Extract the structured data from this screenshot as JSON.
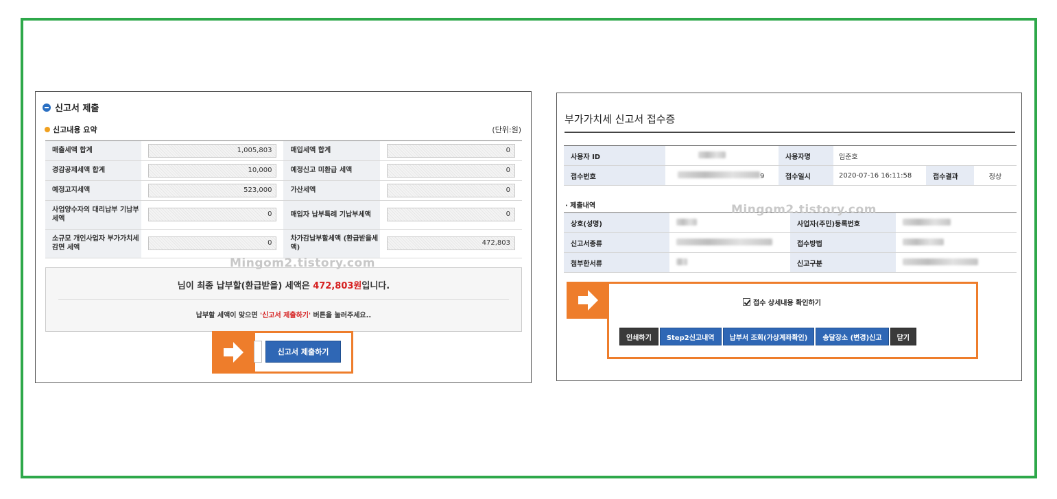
{
  "left": {
    "title": "신고서 제출",
    "subtitle": "신고내용 요약",
    "unit": "(단위:원)",
    "rows": [
      {
        "l1": "매출세액 합계",
        "v1": "1,005,803",
        "l2": "매입세액 합계",
        "v2": "0"
      },
      {
        "l1": "경감공제세액 합계",
        "v1": "10,000",
        "l2": "예정신고 미환급 세액",
        "v2": "0"
      },
      {
        "l1": "예정고지세액",
        "v1": "523,000",
        "l2": "가산세액",
        "v2": "0"
      },
      {
        "l1": "사업양수자의 대리납부 기납부세액",
        "v1": "0",
        "l2": "매입자 납부특례 기납부세액",
        "v2": "0"
      },
      {
        "l1": "소규모 개인사업자 부가가치세 감면 세액",
        "v1": "0",
        "l2": "차가감납부할세액 (환급받을세액)",
        "v2": "472,803"
      }
    ],
    "notice_prefix": "님이 최종 납부할(환급받을) 세액은 ",
    "notice_amount": "472,803원",
    "notice_suffix": "입니다.",
    "sub_prefix": "납부할 세액이 맞으면 ",
    "sub_highlight": "'신고서 제출하기'",
    "sub_suffix": " 버튼을 눌러주세요..",
    "submit_label": "신고서 제출하기",
    "watermark": "Mingom2.tistory.com"
  },
  "right": {
    "title": "부가가치세 신고서 접수증",
    "info": {
      "user_id_label": "사용자 ID",
      "user_name_label": "사용자명",
      "user_name": "임준호",
      "receipt_no_label": "접수번호",
      "receipt_no_suffix": "9",
      "receipt_date_label": "접수일시",
      "receipt_date": "2020-07-16 16:11:58",
      "result_label": "접수결과",
      "result": "정상"
    },
    "section_title": "제출내역",
    "details": [
      {
        "l1": "상호(성명)",
        "l2": "사업자(주민)등록번호"
      },
      {
        "l1": "신고서종류",
        "l2": "접수방법"
      },
      {
        "l1": "첨부한서류",
        "l2": "신고구분"
      }
    ],
    "checkbox_label": "접수 상세내용 확인하기",
    "buttons": {
      "print": "인쇄하기",
      "step2": "Step2신고내역",
      "payment": "납부서 조회(가상계좌확인)",
      "address": "송달장소 (변경)신고",
      "close": "닫기"
    },
    "watermark": "Mingom2.tistory.com"
  },
  "colors": {
    "frame": "#2ea84a",
    "highlight": "#ee7d2b",
    "button_blue": "#2f67b5",
    "button_dark": "#3a3a3a",
    "amount_red": "#d51f1f"
  }
}
